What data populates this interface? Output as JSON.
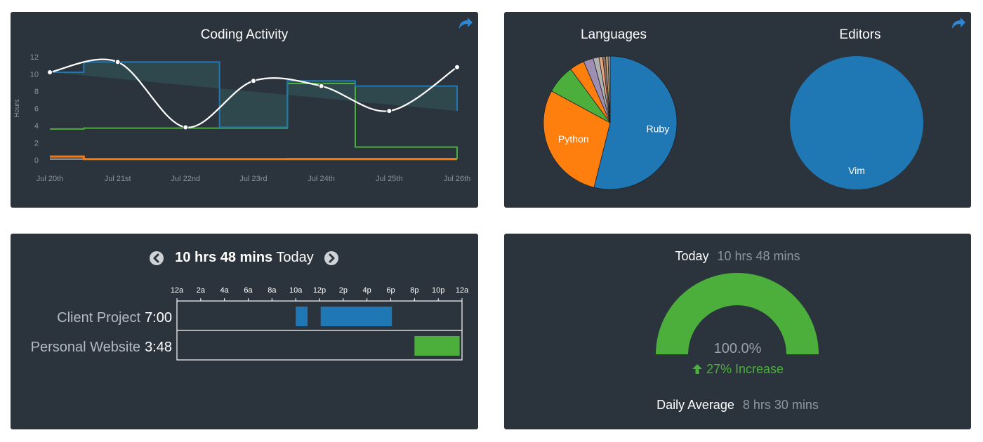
{
  "share_icon_color": "#2f86d3",
  "activity": {
    "title": "Coding Activity",
    "chart_data": {
      "type": "line",
      "title": "Coding Activity",
      "ylabel": "Hours",
      "xlabel": "",
      "ylim": [
        0,
        12
      ],
      "yticks": [
        0,
        2,
        4,
        6,
        8,
        10,
        12
      ],
      "x": [
        "Jul 20th",
        "Jul 21st",
        "Jul 22nd",
        "Jul 23rd",
        "Jul 24th",
        "Jul 25th",
        "Jul 26th"
      ],
      "total_line": {
        "values": [
          10.2,
          11.4,
          3.8,
          9.2,
          8.6,
          5.7,
          10.8
        ],
        "color": "#ffffff"
      },
      "series": [
        {
          "color": "#1f77b4",
          "values": [
            10.2,
            11.4,
            11.4,
            3.8,
            9.2,
            8.6,
            8.6,
            5.7,
            5.7,
            10.8,
            10.8
          ]
        },
        {
          "color": "#4caf3c",
          "values": [
            3.6,
            3.7,
            3.7,
            3.7,
            8.9,
            1.5,
            1.5,
            0.1,
            0.1,
            3.8,
            3.8
          ]
        },
        {
          "color": "#f07a18",
          "values": [
            0.4,
            0.1,
            0.1,
            0.1,
            0.1,
            0.1,
            0.1,
            0.1,
            0.1,
            0.1,
            0.1
          ]
        },
        {
          "color": "#9a9ca6",
          "values": [
            0.1,
            0.1,
            0.1,
            0.1,
            0.15,
            0.15,
            0.15,
            0.1,
            0.1,
            0.1,
            0.1
          ]
        }
      ]
    }
  },
  "languages": {
    "title": "Languages",
    "chart_data": {
      "type": "pie",
      "title": "Languages",
      "slices": [
        {
          "label": "Ruby",
          "value": 53.9,
          "color": "#1f77b4"
        },
        {
          "label": "Python",
          "value": 29.0,
          "color": "#ff7f0e"
        },
        {
          "label": "",
          "value": 7.0,
          "color": "#4caf3c"
        },
        {
          "label": "",
          "value": 3.6,
          "color": "#ff7f0e"
        },
        {
          "label": "",
          "value": 2.4,
          "color": "#9e8fb2"
        },
        {
          "label": "",
          "value": 1.4,
          "color": "#b0b0b0"
        },
        {
          "label": "",
          "value": 0.9,
          "color": "#e6a57a"
        },
        {
          "label": "",
          "value": 0.7,
          "color": "#8c6d62"
        },
        {
          "label": "",
          "value": 0.6,
          "color": "#c7a46a"
        },
        {
          "label": "",
          "value": 0.5,
          "color": "#9a9ca6"
        }
      ]
    }
  },
  "editors": {
    "title": "Editors",
    "chart_data": {
      "type": "pie",
      "title": "Editors",
      "slices": [
        {
          "label": "Vim",
          "value": 100,
          "color": "#1f77b4"
        }
      ]
    }
  },
  "timeline": {
    "total": "10 hrs 48 mins",
    "suffix": "Today",
    "hour_labels": [
      "12a",
      "2a",
      "4a",
      "6a",
      "8a",
      "10a",
      "12p",
      "2p",
      "4p",
      "6p",
      "8p",
      "10p",
      "12a"
    ],
    "projects": [
      {
        "name": "Client Project",
        "duration": "7:00",
        "color": "#1f77b4",
        "blocks": [
          [
            10.0,
            11.0
          ],
          [
            12.1,
            18.1
          ]
        ]
      },
      {
        "name": "Personal Website",
        "duration": "3:48",
        "color": "#4caf3c",
        "blocks": [
          [
            20.0,
            23.8
          ]
        ]
      }
    ]
  },
  "goal": {
    "today_label": "Today",
    "today_value": "10 hrs 48 mins",
    "percent": "100.0%",
    "gauge_fraction": 1.0,
    "gauge_color": "#4caf3c",
    "change": "27% Increase",
    "change_color": "#4caf3c",
    "avg_label": "Daily Average",
    "avg_value": "8 hrs 30 mins"
  }
}
